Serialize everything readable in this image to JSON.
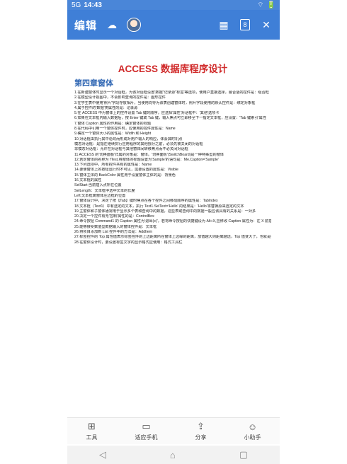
{
  "status": {
    "signal": "5G",
    "time": "14:43",
    "battery": "🔋"
  },
  "appbar": {
    "title": "编辑",
    "page_badge": "8"
  },
  "doc": {
    "title": "ACCESS 数据库程序设计",
    "chapter": "第四章窗体",
    "lines": [
      "1.在新建窗体时显示一个对话框，为该对话框设置'数据''记录源''标签'等选项，使用户直接选择，最合适的控件是：组合框",
      "2.在模型设计视图中，不会影响查询的控件是：图形控件",
      "3.在学生表中使用'照片'字段存放相片，当使用向导为该表创建窗体时，照片字段使用的默认控件是：绑定对象框",
      "4.属于控件的'数据'类属性的是：记录源",
      "5.在 ACCESS 中为窗体上的控件设置 Tab 键的顺序，应选择'属性'对话框中：'其他'选项卡",
      "6.如果在文本框内输入数据后，按 Enter 键或 Tab 键，输入焦点可立即移至下一指定文本框，应设置：'Tab 键索引'属性",
      "7.窗体 Caption 属性的作用是：确定窗体的标题",
      "8.在代码中引用一个窗体控件时，应使用的控件属性是：Name",
      "9.确定一个窗体大小的属性是：Width 和 Height",
      "10.对话框由执行其中语句而形成对用户输入的响应，体会其时机点",
      "模态对话框：是指在继续执行应用程序的其他部分之前，必须先被关闭的对话框",
      "非模态对话框：允许在对话框与其他窗体间转移焦点而不必关闭对话框",
      "11 ACCESS 的'切换面板'归属的对象是：窗体。'切换面板'(SwitchBoard)是一种特殊型的窗体",
      "12.若定窗体的名称为 fTest,将窗体的标题设置为'Sample'的语句是：Me.Caption='Sample'",
      "13.下列选项中，所有控件共有的属性是：Name",
      "14.要使窗体上的按钮运行时不可见，需要设置的属性是：Visible",
      "15.窗体主体的 BackColor 属性用于设置窗体主体的是：背景色",
      "16.文本框的属性",
      "SelStart:当前插入点所在位置",
      "SelLength：文本框中选中文本的长度",
      "Left:文本框离窗体左边框的位置",
      "17.窗体设计中，决定了按【Tab】键时焦点在各个控件之间移动顺序的属性是：TabIndex",
      "18.文本框（Text1）中有选定的文本，执行 Text1.SelText='Hello' 的结果是：'Hello'将替换原来选定的文本",
      "19.主窗体和子窗体通常用于显示多个表和查询中的数据，这些表或查询中的数据一般应该具有的关系是：一对多",
      "20.决定一个控件有无'控制'属性的是：ControlBox",
      "24.命令按钮 Command1 的 Caption 属性为'退出(x)'，若将命令按钮的快捷键设为 Alt+X,应修改 Caption 属性为：在 X 前插入&",
      "25.能够接受数值型数据输入的窗体控件是：文本框",
      "26.将项目添加到 List 控件中的方法是：AddItem",
      "27.标签控件的 Top 属性值表示标签控件的上边距离所在窗体上边缘的距离，放值越大则距离越远，Top 值变大了，也就是控件距离窗体上边缘远了，即控件位置下移了",
      "28.在窗体设计时，要设置标签文字的显示格式应使用：格式工具栏"
    ]
  },
  "toolbar": {
    "items": [
      {
        "label": "工具",
        "icon": "grid-icon"
      },
      {
        "label": "适应手机",
        "icon": "phone-fit-icon"
      },
      {
        "label": "分享",
        "icon": "share-icon"
      },
      {
        "label": "小助手",
        "icon": "assistant-icon"
      }
    ]
  }
}
